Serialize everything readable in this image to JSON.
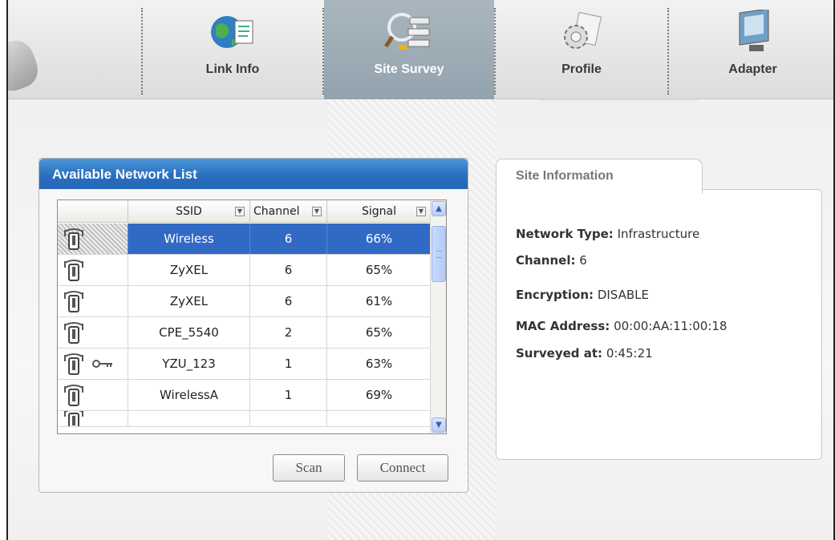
{
  "nav": {
    "tabs": [
      {
        "label": "Link Info",
        "icon": "globe-doc-icon",
        "active": false
      },
      {
        "label": "Site Survey",
        "icon": "network-survey-icon",
        "active": true
      },
      {
        "label": "Profile",
        "icon": "gear-doc-icon",
        "active": false
      },
      {
        "label": "Adapter",
        "icon": "adapter-icon",
        "active": false
      }
    ]
  },
  "network_list": {
    "title": "Available Network List",
    "columns": {
      "ssid": "SSID",
      "channel": "Channel",
      "signal": "Signal"
    },
    "rows": [
      {
        "ssid": "Wireless",
        "channel": "6",
        "signal": "66%",
        "selected": true,
        "encrypted": false
      },
      {
        "ssid": "ZyXEL",
        "channel": "6",
        "signal": "65%",
        "selected": false,
        "encrypted": false
      },
      {
        "ssid": "ZyXEL",
        "channel": "6",
        "signal": "61%",
        "selected": false,
        "encrypted": false
      },
      {
        "ssid": "CPE_5540",
        "channel": "2",
        "signal": "65%",
        "selected": false,
        "encrypted": false
      },
      {
        "ssid": "YZU_123",
        "channel": "1",
        "signal": "63%",
        "selected": false,
        "encrypted": true
      },
      {
        "ssid": "WirelessA",
        "channel": "1",
        "signal": "69%",
        "selected": false,
        "encrypted": false
      }
    ],
    "buttons": {
      "scan": "Scan",
      "connect": "Connect"
    }
  },
  "site_info": {
    "tab_label": "Site Information",
    "network_type": {
      "label": "Network Type:",
      "value": "Infrastructure"
    },
    "channel": {
      "label": "Channel:",
      "value": "6"
    },
    "encryption": {
      "label": "Encryption:",
      "value": "DISABLE"
    },
    "mac_address": {
      "label": "MAC Address:",
      "value": "00:00:AA:11:00:18"
    },
    "surveyed_at": {
      "label": "Surveyed at:",
      "value": "0:45:21"
    }
  },
  "colors": {
    "header_blue": "#2a6fc0",
    "selection_blue": "#316ac5",
    "active_tab": "#9eadb7"
  }
}
